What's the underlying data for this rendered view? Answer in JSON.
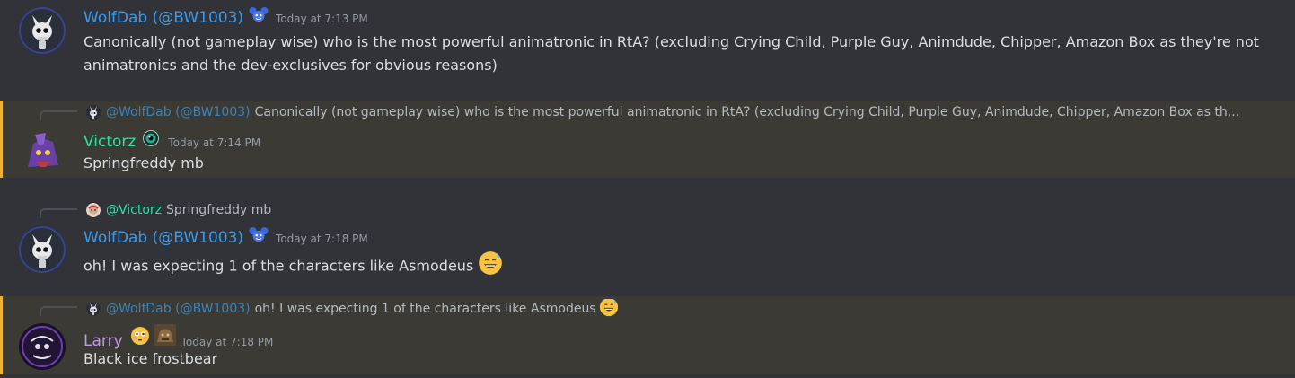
{
  "colors": {
    "background": "#313338",
    "highlight_bg": "#3b3a34",
    "highlight_bar": "#f0b232",
    "wolfdab": "#3b9ae8",
    "victorz": "#27e3a2",
    "larry": "#c09ae2",
    "timestamp": "#949ba4",
    "text": "#dbdee1"
  },
  "messages": [
    {
      "author": "WolfDab (@BW1003)",
      "timestamp": "Today at 7:13 PM",
      "text": "Canonically (not gameplay wise) who is the most powerful animatronic in RtA? (excluding Crying Child, Purple Guy, Animdude, Chipper, Amazon Box as they're not animatronics and the dev-exclusives for obvious reasons)",
      "avatar_icon": "skeleton-bunny-avatar",
      "badge_icon": "blue-mouse-badge-icon"
    },
    {
      "reply_mention": "@WolfDab (@BW1003)",
      "reply_text": "Canonically (not gameplay wise) who is the most powerful animatronic in RtA? (excluding Crying Child, Purple Guy, Animdude, Chipper, Amazon Box as th...",
      "author": "Victorz",
      "timestamp": "Today at 7:14 PM",
      "text": "Springfreddy mb",
      "avatar_icon": "purple-animatronic-avatar",
      "badge_icon": "eye-badge-icon"
    },
    {
      "reply_mention": "@Victorz",
      "reply_text": "Springfreddy mb",
      "author": "WolfDab (@BW1003)",
      "timestamp": "Today at 7:18 PM",
      "text": "oh! I was expecting 1 of the characters like Asmodeus",
      "avatar_icon": "skeleton-bunny-avatar",
      "badge_icon": "blue-mouse-badge-icon",
      "emoji_icon": "grinning-sweat-emoji"
    },
    {
      "reply_mention": "@WolfDab (@BW1003)",
      "reply_text": "oh! I was expecting 1 of the characters like Asmodeus",
      "author": "Larry",
      "timestamp": "Today at 7:18 PM",
      "text": "Black ice frostbear",
      "avatar_icon": "dark-circle-avatar",
      "badge_icon": "flushed-face-badge-icon",
      "emoji_icon": "grinning-sweat-emoji"
    }
  ]
}
